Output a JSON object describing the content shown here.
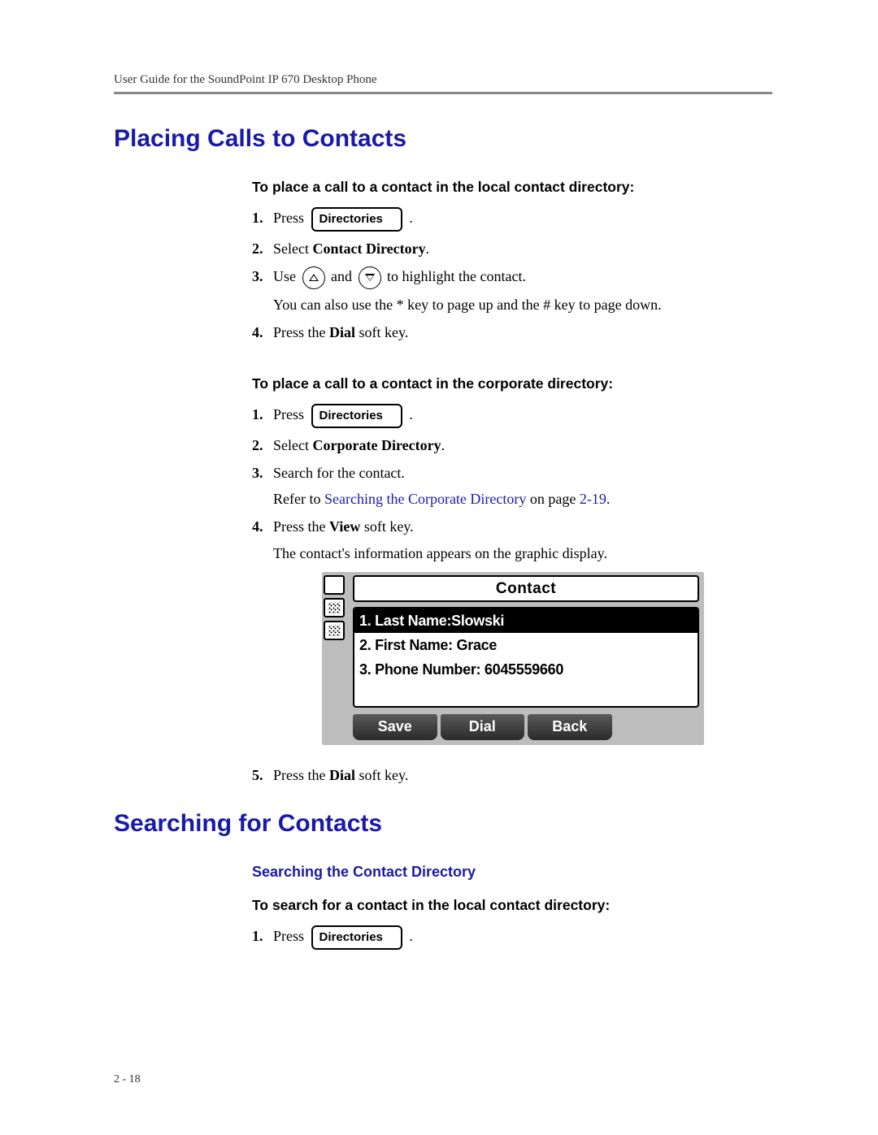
{
  "header": "User Guide for the SoundPoint IP 670 Desktop Phone",
  "page_number": "2 - 18",
  "sections": {
    "placing_calls": {
      "title": "Placing Calls to Contacts",
      "local": {
        "heading": "To place a call to a contact in the local contact directory:",
        "steps": {
          "s1_a": "Press",
          "s1_btn": "Directories",
          "s1_b": ".",
          "s2_a": "Select ",
          "s2_bold": "Contact Directory",
          "s2_b": ".",
          "s3_a": "Use ",
          "s3_b": " and ",
          "s3_c": " to highlight the contact.",
          "s3_sub": "You can also use the * key to page up and the # key to page down.",
          "s4_a": "Press the ",
          "s4_bold": "Dial",
          "s4_b": " soft key."
        }
      },
      "corporate": {
        "heading": "To place a call to a contact in the corporate directory:",
        "steps": {
          "s1_a": "Press",
          "s1_btn": "Directories",
          "s1_b": ".",
          "s2_a": "Select ",
          "s2_bold": "Corporate Directory",
          "s2_b": ".",
          "s3_a": "Search for the contact.",
          "s3_sub_a": "Refer to ",
          "s3_link": "Searching the Corporate Directory",
          "s3_sub_b": " on page ",
          "s3_page": "2-19",
          "s3_sub_c": ".",
          "s4_a": "Press the ",
          "s4_bold": "View",
          "s4_b": " soft key.",
          "s4_sub": "The contact's information appears on the graphic display.",
          "s5_a": "Press the ",
          "s5_bold": "Dial",
          "s5_b": " soft key."
        }
      }
    },
    "searching": {
      "title": "Searching for Contacts",
      "subtitle": "Searching the Contact Directory",
      "local": {
        "heading": "To search for a contact in the local contact directory:",
        "steps": {
          "s1_a": "Press",
          "s1_btn": "Directories",
          "s1_b": "."
        }
      }
    }
  },
  "phone_screen": {
    "title": "Contact",
    "rows": [
      "1. Last Name:Slowski",
      "2. First Name: Grace",
      "3. Phone Number: 6045559660"
    ],
    "softkeys": [
      "Save",
      "Dial",
      "Back"
    ]
  }
}
